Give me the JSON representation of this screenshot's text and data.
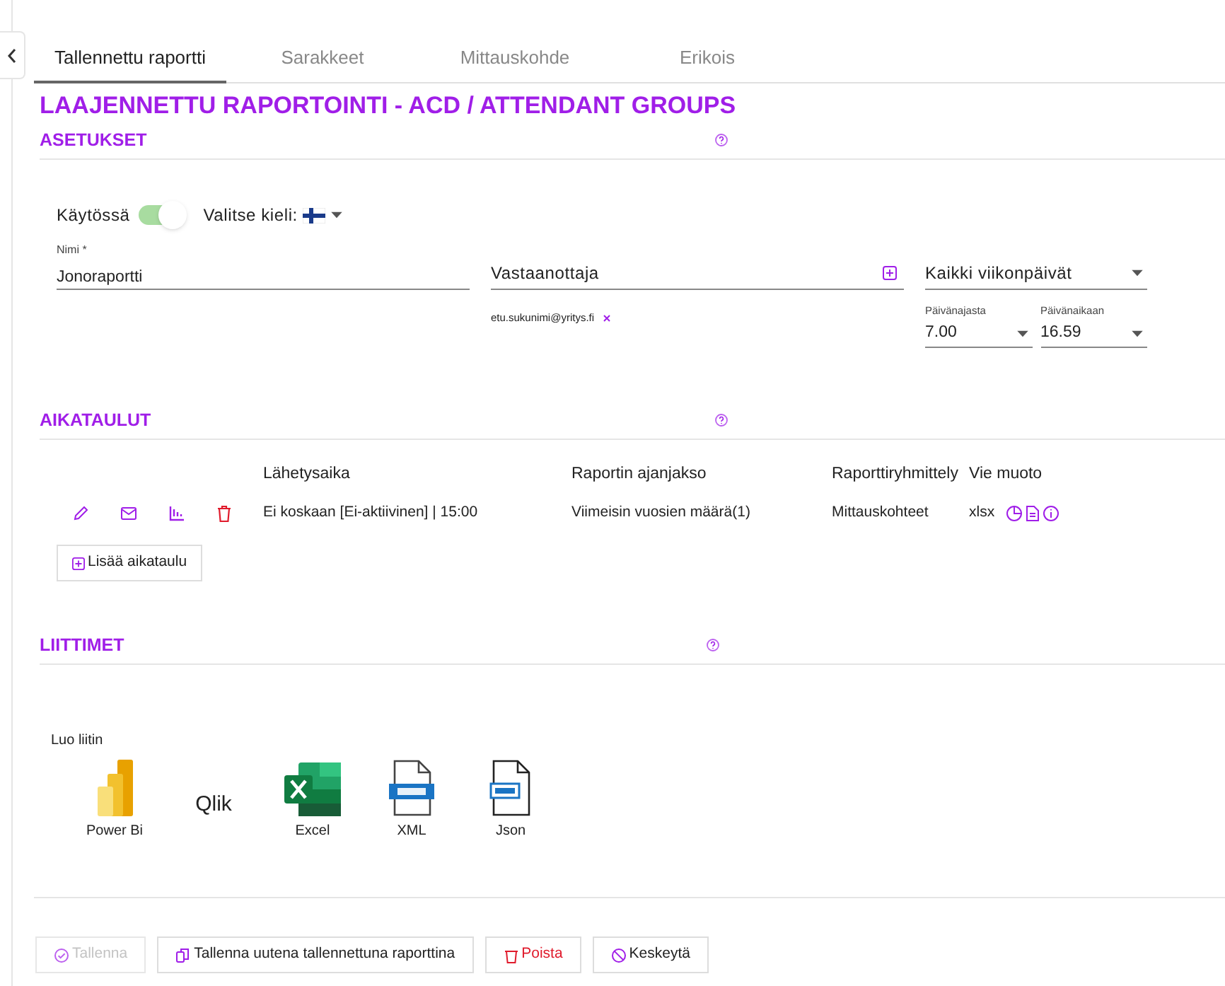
{
  "tabs": [
    {
      "label": "Tallennettu raportti",
      "selected": true
    },
    {
      "label": "Sarakkeet",
      "selected": false
    },
    {
      "label": "Mittauskohde",
      "selected": false
    },
    {
      "label": "Erikois",
      "selected": false
    }
  ],
  "title": "LAAJENNETTU RAPORTOINTI - ACD / ATTENDANT GROUPS",
  "settings": {
    "heading": "ASETUKSET",
    "enabled": {
      "label": "Käytössä",
      "on": true
    },
    "language_label": "Valitse kieli:",
    "name_field": {
      "label": "Nimi *",
      "value": "Jonoraportti"
    },
    "recipient_field": {
      "placeholder": "Vastaanottaja"
    },
    "recipients": [
      "etu.sukunimi@yritys.fi"
    ],
    "weekdays": {
      "value": "Kaikki viikonpäivät"
    },
    "time_from": {
      "label": "Päivänajasta",
      "value": "7.00"
    },
    "time_to": {
      "label": "Päivänaikaan",
      "value": "16.59"
    }
  },
  "schedules": {
    "heading": "AIKATAULUT",
    "columns": [
      "Lähetysaika",
      "Raportin ajanjakso",
      "Raporttiryhmittely",
      "Vie muoto"
    ],
    "rows": [
      {
        "cells": [
          "Ei koskaan [Ei-aktiivinen] | 15:00",
          "Viimeisin vuosien määrä(1)",
          "Mittauskohteet",
          "xlsx"
        ]
      }
    ],
    "add_button": "Lisää aikataulu"
  },
  "connectors": {
    "heading": "LIITTIMET",
    "label": "Luo liitin",
    "items": [
      {
        "kind": "powerbi",
        "label": "Power Bi"
      },
      {
        "kind": "qlik",
        "label": "Qlik"
      },
      {
        "kind": "excel",
        "label": "Excel"
      },
      {
        "kind": "xml",
        "label": "XML"
      },
      {
        "kind": "json",
        "label": "Json"
      }
    ]
  },
  "buttons": [
    {
      "kind": "save",
      "label": "Tallenna",
      "disabled": true
    },
    {
      "kind": "saveas",
      "label": "Tallenna uutena tallennettuna raporttina",
      "disabled": false
    },
    {
      "kind": "delete",
      "label": "Poista",
      "disabled": false
    },
    {
      "kind": "cancel",
      "label": "Keskeytä",
      "disabled": false
    }
  ]
}
